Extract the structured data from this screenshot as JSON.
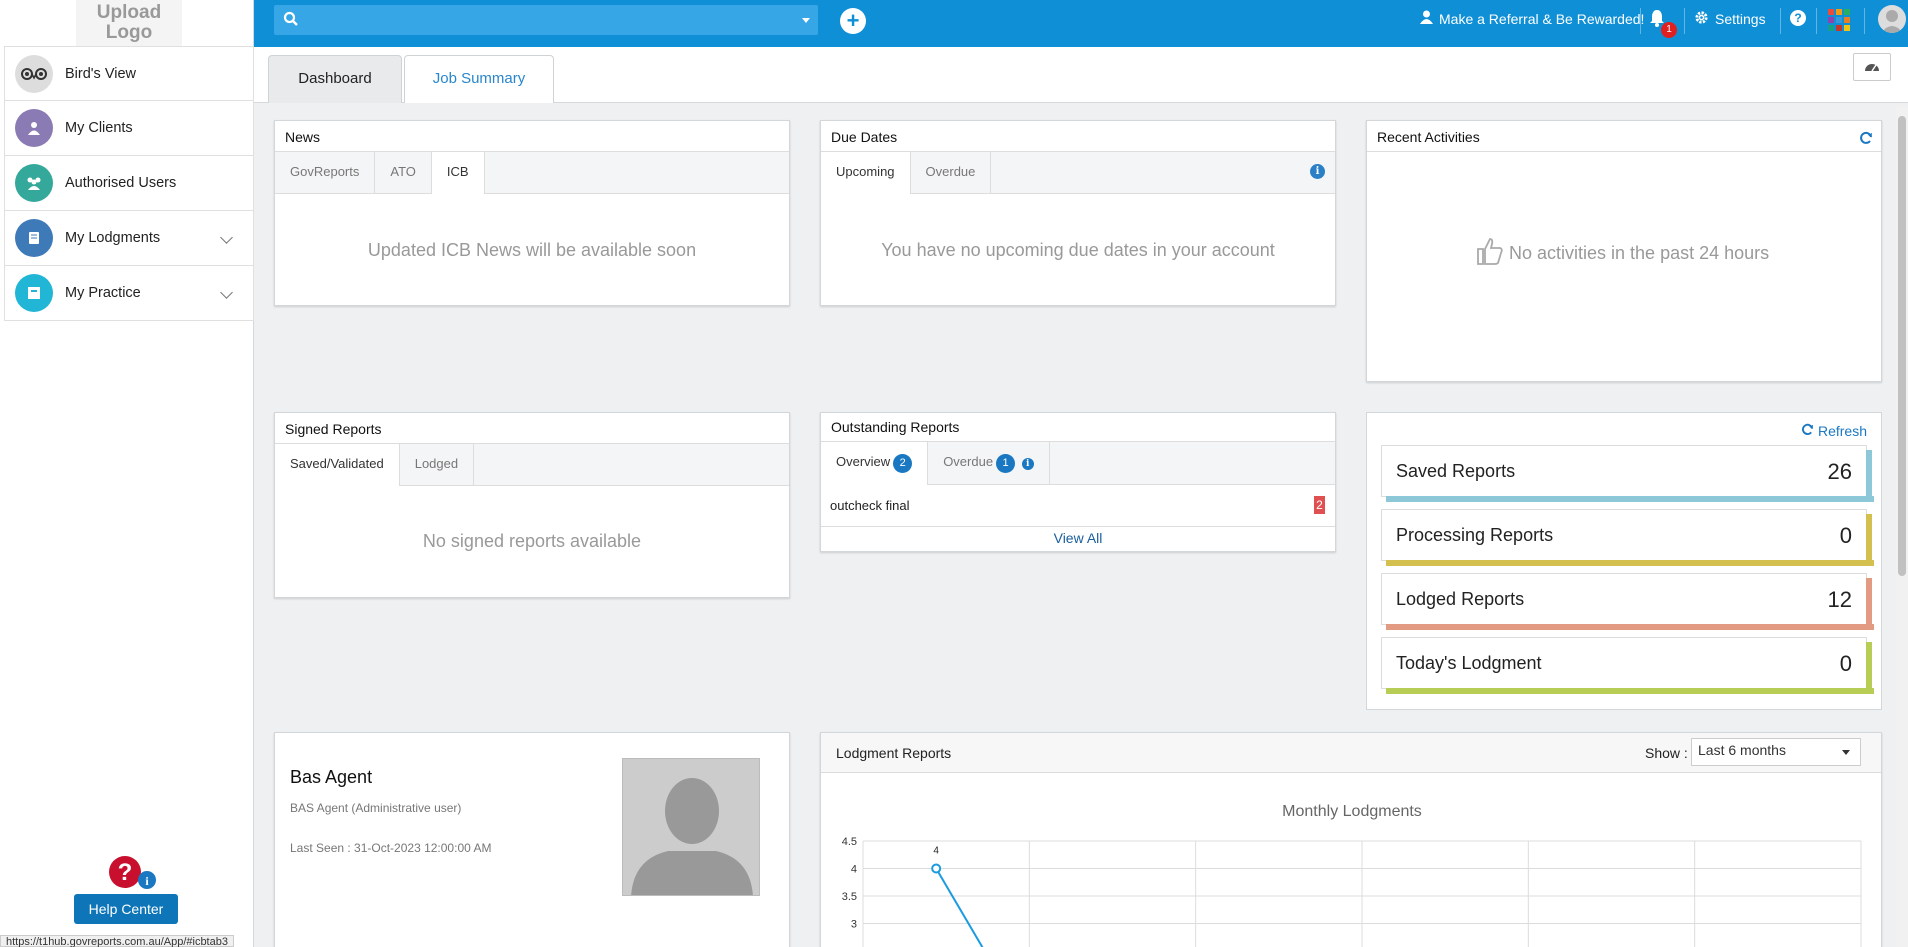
{
  "sidebar": {
    "logo_text": "Upload Logo",
    "items": [
      {
        "label": "Bird's View",
        "icon": "owl-icon",
        "color": "#dddddd"
      },
      {
        "label": "My Clients",
        "icon": "user-icon",
        "color": "#8b7bb4"
      },
      {
        "label": "Authorised Users",
        "icon": "users-icon",
        "color": "#34a89b"
      },
      {
        "label": "My Lodgments",
        "icon": "book-icon",
        "color": "#3f7ab8"
      },
      {
        "label": "My Practice",
        "icon": "box-icon",
        "color": "#21b6d6"
      }
    ],
    "help_center": "Help Center"
  },
  "topbar": {
    "search_placeholder": "",
    "referral": "Make a Referral & Be Rewarded!",
    "notification_count": "1",
    "settings": "Settings",
    "brand_color": "#0e8fd6"
  },
  "tabs": {
    "dashboard": "Dashboard",
    "job_summary": "Job Summary"
  },
  "news": {
    "title": "News",
    "tabs": [
      "GovReports",
      "ATO",
      "ICB"
    ],
    "active_tab": "ICB",
    "message": "Updated ICB News will be available soon"
  },
  "due_dates": {
    "title": "Due Dates",
    "tabs": [
      "Upcoming",
      "Overdue"
    ],
    "active_tab": "Upcoming",
    "message": "You have no upcoming due dates in your account"
  },
  "recent": {
    "title": "Recent Activities",
    "message": "No activities in the past 24 hours"
  },
  "signed": {
    "title": "Signed Reports",
    "tabs": [
      "Saved/Validated",
      "Lodged"
    ],
    "active_tab": "Saved/Validated",
    "message": "No signed reports available"
  },
  "outstanding": {
    "title": "Outstanding Reports",
    "overview_label": "Overview",
    "overview_count": "2",
    "overdue_label": "Overdue",
    "overdue_count": "1",
    "row_label": "outcheck final",
    "row_count": "2",
    "view_all": "View All"
  },
  "stats": {
    "refresh": "Refresh",
    "items": [
      {
        "label": "Saved Reports",
        "value": "26",
        "color": "#8cc8d8"
      },
      {
        "label": "Processing Reports",
        "value": "0",
        "color": "#d4c04e"
      },
      {
        "label": "Lodged Reports",
        "value": "12",
        "color": "#e39a83"
      },
      {
        "label": "Today's Lodgment",
        "value": "0",
        "color": "#b8cd55"
      }
    ]
  },
  "profile": {
    "name": "Bas Agent",
    "role": "BAS Agent (Administrative user)",
    "last_seen": "Last Seen : 31-Oct-2023 12:00:00 AM"
  },
  "lodgment": {
    "title": "Lodgment Reports",
    "show_label": "Show :",
    "range": "Last 6 months"
  },
  "chart_data": {
    "type": "line",
    "title": "Monthly Lodgments",
    "y_ticks": [
      "4.5",
      "4",
      "3.5",
      "3"
    ],
    "visible_points": [
      {
        "x_index": 0,
        "y": 4,
        "label": "4"
      }
    ],
    "series_color": "#1a9be0",
    "grid": true
  },
  "statusbar": {
    "url": "https://t1hub.govreports.com.au/App/#icbtab3"
  }
}
